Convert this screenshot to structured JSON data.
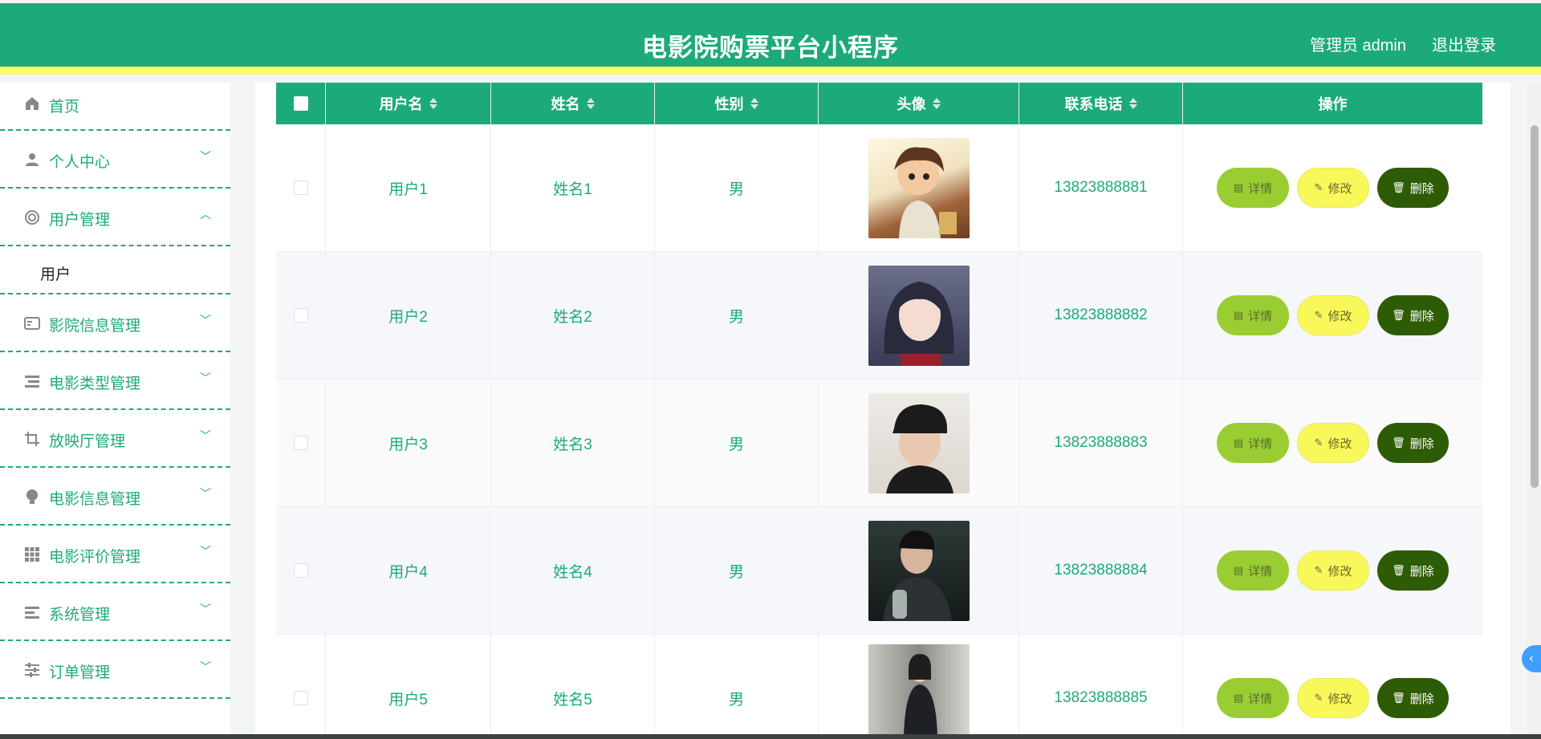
{
  "header": {
    "title": "电影院购票平台小程序",
    "user": "管理员 admin",
    "logout": "退出登录"
  },
  "sidebar": {
    "items": [
      {
        "label": "首页",
        "icon": "home-icon"
      },
      {
        "label": "个人中心",
        "icon": "person-icon",
        "chevron": "down"
      },
      {
        "label": "用户管理",
        "icon": "user-manage-icon",
        "chevron": "up"
      },
      {
        "label": "影院信息管理",
        "icon": "card-icon",
        "chevron": "down"
      },
      {
        "label": "电影类型管理",
        "icon": "list-icon",
        "chevron": "down"
      },
      {
        "label": "放映厅管理",
        "icon": "crop-icon",
        "chevron": "down"
      },
      {
        "label": "电影信息管理",
        "icon": "bulb-icon",
        "chevron": "down"
      },
      {
        "label": "电影评价管理",
        "icon": "grid-icon",
        "chevron": "down"
      },
      {
        "label": "系统管理",
        "icon": "menu-icon",
        "chevron": "down"
      },
      {
        "label": "订单管理",
        "icon": "sliders-icon",
        "chevron": "down"
      }
    ],
    "submenu": "用户"
  },
  "table": {
    "columns": [
      "用户名",
      "姓名",
      "性别",
      "头像",
      "联系电话",
      "操作"
    ],
    "rows": [
      {
        "username": "用户1",
        "name": "姓名1",
        "gender": "男",
        "phone": "13823888881"
      },
      {
        "username": "用户2",
        "name": "姓名2",
        "gender": "男",
        "phone": "13823888882"
      },
      {
        "username": "用户3",
        "name": "姓名3",
        "gender": "男",
        "phone": "13823888883"
      },
      {
        "username": "用户4",
        "name": "姓名4",
        "gender": "男",
        "phone": "13823888884"
      },
      {
        "username": "用户5",
        "name": "姓名5",
        "gender": "男",
        "phone": "13823888885"
      }
    ],
    "actions": {
      "detail": "详情",
      "edit": "修改",
      "delete": "删除"
    }
  },
  "colors": {
    "primary": "#1daa7b",
    "accent_yellow": "#f9ff6b",
    "detail_btn": "#9acd32",
    "edit_btn": "#f9f85b",
    "delete_btn": "#2e5b05"
  }
}
